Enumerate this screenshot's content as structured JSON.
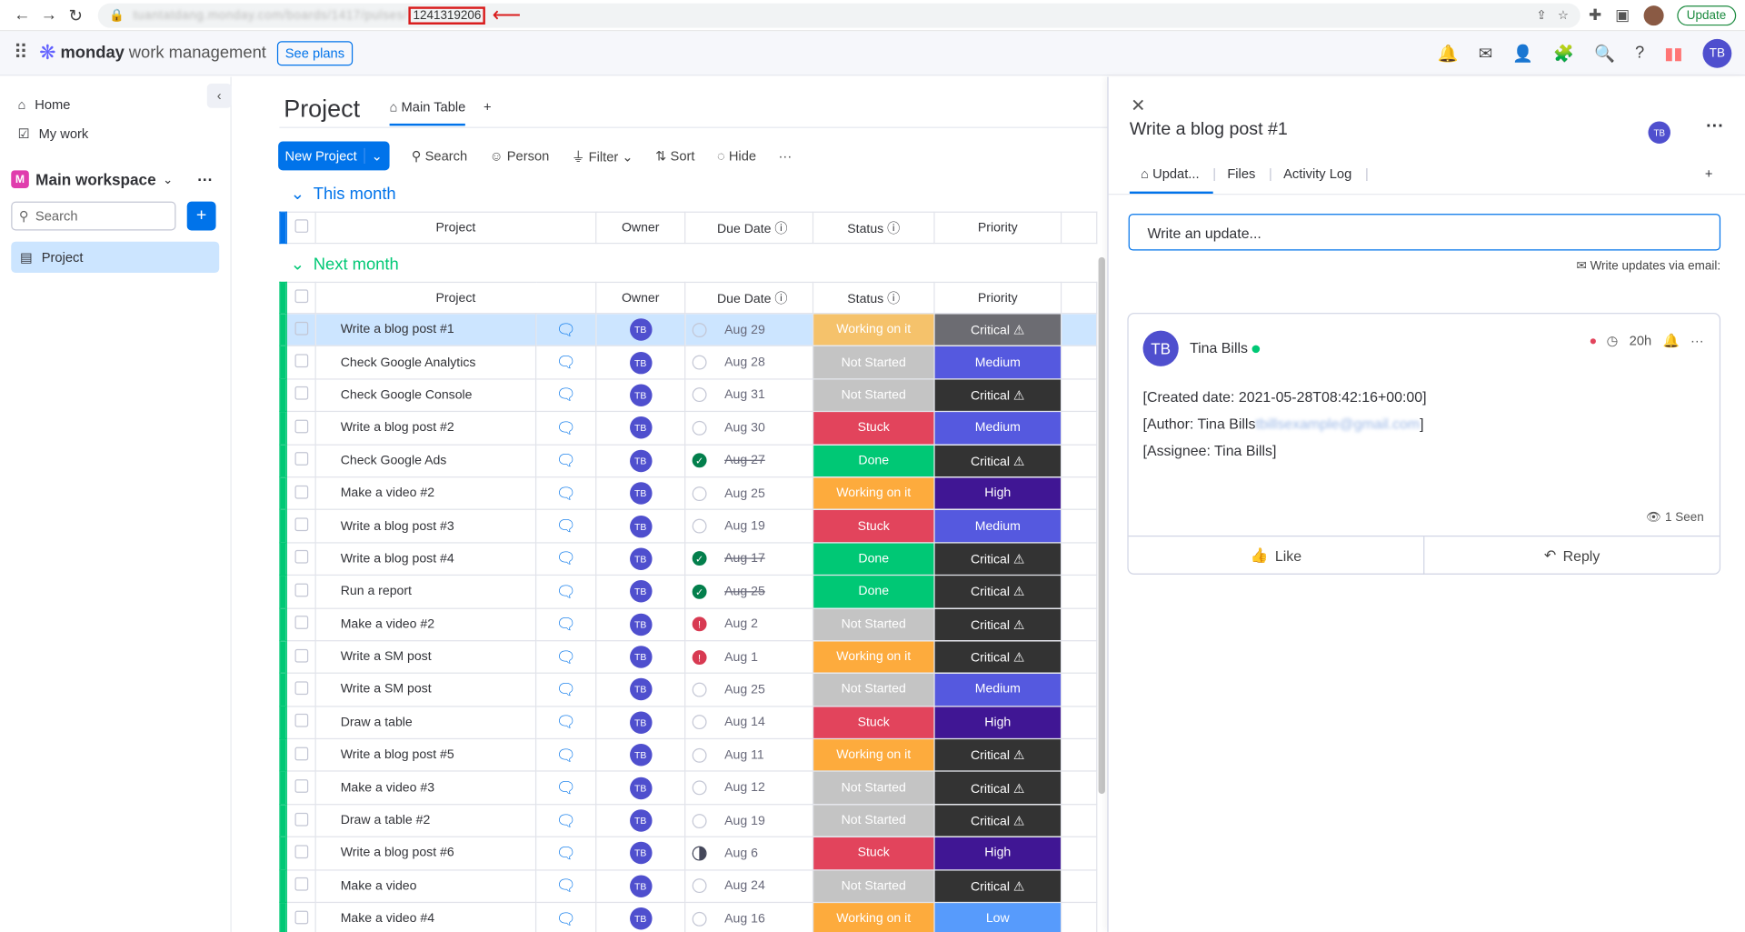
{
  "browser": {
    "url_hidden": "tuantatdang.monday.com/boards/1417/pulses/",
    "url_id": "1241319206",
    "update_label": "Update"
  },
  "topnav": {
    "brand": "monday",
    "brand_sub": "work management",
    "see_plans": "See plans",
    "avatar": "TB"
  },
  "sidebar": {
    "home": "Home",
    "my_work": "My work",
    "workspace": "Main workspace",
    "search_placeholder": "Search",
    "board": "Project"
  },
  "board": {
    "title": "Project",
    "tab_main": "Main Table",
    "tab_add": "+",
    "toolbar": {
      "new_project": "New Project",
      "search": "Search",
      "person": "Person",
      "filter": "Filter",
      "sort": "Sort",
      "hide": "Hide",
      "more": "···"
    },
    "groups": {
      "this_month": "This month",
      "next_month": "Next month"
    },
    "columns": {
      "project": "Project",
      "owner": "Owner",
      "due_date": "Due Date",
      "status": "Status",
      "priority": "Priority"
    },
    "rows": [
      {
        "name": "Write a blog post #1",
        "owner": "TB",
        "date": "Aug 29",
        "due_icon": "empty",
        "status": "Working on it",
        "priority": "Critical ⚠",
        "selected": true
      },
      {
        "name": "Check Google Analytics",
        "owner": "TB",
        "date": "Aug 28",
        "due_icon": "empty",
        "status": "Not Started",
        "priority": "Medium"
      },
      {
        "name": "Check Google Console",
        "owner": "TB",
        "date": "Aug 31",
        "due_icon": "empty",
        "status": "Not Started",
        "priority": "Critical ⚠"
      },
      {
        "name": "Write a blog post #2",
        "owner": "TB",
        "date": "Aug 30",
        "due_icon": "empty",
        "status": "Stuck",
        "priority": "Medium"
      },
      {
        "name": "Check Google Ads",
        "owner": "TB",
        "date": "Aug 27",
        "due_icon": "ok",
        "strike": true,
        "status": "Done",
        "priority": "Critical ⚠"
      },
      {
        "name": "Make a video #2",
        "owner": "TB",
        "date": "Aug 25",
        "due_icon": "empty",
        "status": "Working on it",
        "priority": "High"
      },
      {
        "name": "Write a blog post #3",
        "owner": "TB",
        "date": "Aug 19",
        "due_icon": "empty",
        "status": "Stuck",
        "priority": "Medium"
      },
      {
        "name": "Write a blog post #4",
        "owner": "TB",
        "date": "Aug 17",
        "due_icon": "ok",
        "strike": true,
        "status": "Done",
        "priority": "Critical ⚠"
      },
      {
        "name": "Run a report",
        "owner": "TB",
        "date": "Aug 25",
        "due_icon": "ok",
        "strike": true,
        "status": "Done",
        "priority": "Critical ⚠"
      },
      {
        "name": "Make a video #2",
        "owner": "TB",
        "date": "Aug 2",
        "due_icon": "warn",
        "status": "Not Started",
        "priority": "Critical ⚠"
      },
      {
        "name": "Write a SM post",
        "owner": "TB",
        "date": "Aug 1",
        "due_icon": "warn",
        "status": "Working on it",
        "priority": "Critical ⚠"
      },
      {
        "name": "Write a SM post",
        "owner": "TB",
        "date": "Aug 25",
        "due_icon": "empty",
        "status": "Not Started",
        "priority": "Medium"
      },
      {
        "name": "Draw a table",
        "owner": "TB",
        "date": "Aug 14",
        "due_icon": "empty",
        "status": "Stuck",
        "priority": "High"
      },
      {
        "name": "Write a blog post #5",
        "owner": "TB",
        "date": "Aug 11",
        "due_icon": "empty",
        "status": "Working on it",
        "priority": "Critical ⚠"
      },
      {
        "name": "Make a video #3",
        "owner": "TB",
        "date": "Aug 12",
        "due_icon": "empty",
        "status": "Not Started",
        "priority": "Critical ⚠"
      },
      {
        "name": "Draw a table #2",
        "owner": "TB",
        "date": "Aug 19",
        "due_icon": "empty",
        "status": "Not Started",
        "priority": "Critical ⚠"
      },
      {
        "name": "Write a blog post #6",
        "owner": "TB",
        "date": "Aug 6",
        "due_icon": "half",
        "status": "Stuck",
        "priority": "High"
      },
      {
        "name": "Make a video",
        "owner": "TB",
        "date": "Aug 24",
        "due_icon": "empty",
        "status": "Not Started",
        "priority": "Critical ⚠"
      },
      {
        "name": "Make a video #4",
        "owner": "TB",
        "date": "Aug 16",
        "due_icon": "empty",
        "status": "Working on it",
        "priority": "Low"
      }
    ]
  },
  "colors": {
    "Working on it": "#fdab3d",
    "Not Started": "#c4c4c4",
    "Stuck": "#e2445c",
    "Done": "#00c875",
    "Critical ⚠": "#333333",
    "Medium": "#5559df",
    "High": "#401694",
    "Low": "#579bfc",
    "selected_working": "#f5c26b",
    "selected_critical": "#6c6c72"
  },
  "panel": {
    "title": "Write a blog post #1",
    "avatar": "TB",
    "tab_updates": "Updat...",
    "tab_files": "Files",
    "tab_activity": "Activity Log",
    "tab_add": "+",
    "input_placeholder": "Write an update...",
    "email_hint": "Write updates via email:",
    "post": {
      "author": "Tina Bills",
      "avatar": "TB",
      "time": "20h",
      "line1": "[Created date: 2021-05-28T08:42:16+00:00]",
      "line2_prefix": "[Author: Tina Bills",
      "line2_email": "tbillsexample@gmail.com",
      "line2_suffix": "]",
      "line3": "[Assignee: Tina Bills]",
      "seen": "1 Seen",
      "like": "Like",
      "reply": "Reply"
    }
  }
}
